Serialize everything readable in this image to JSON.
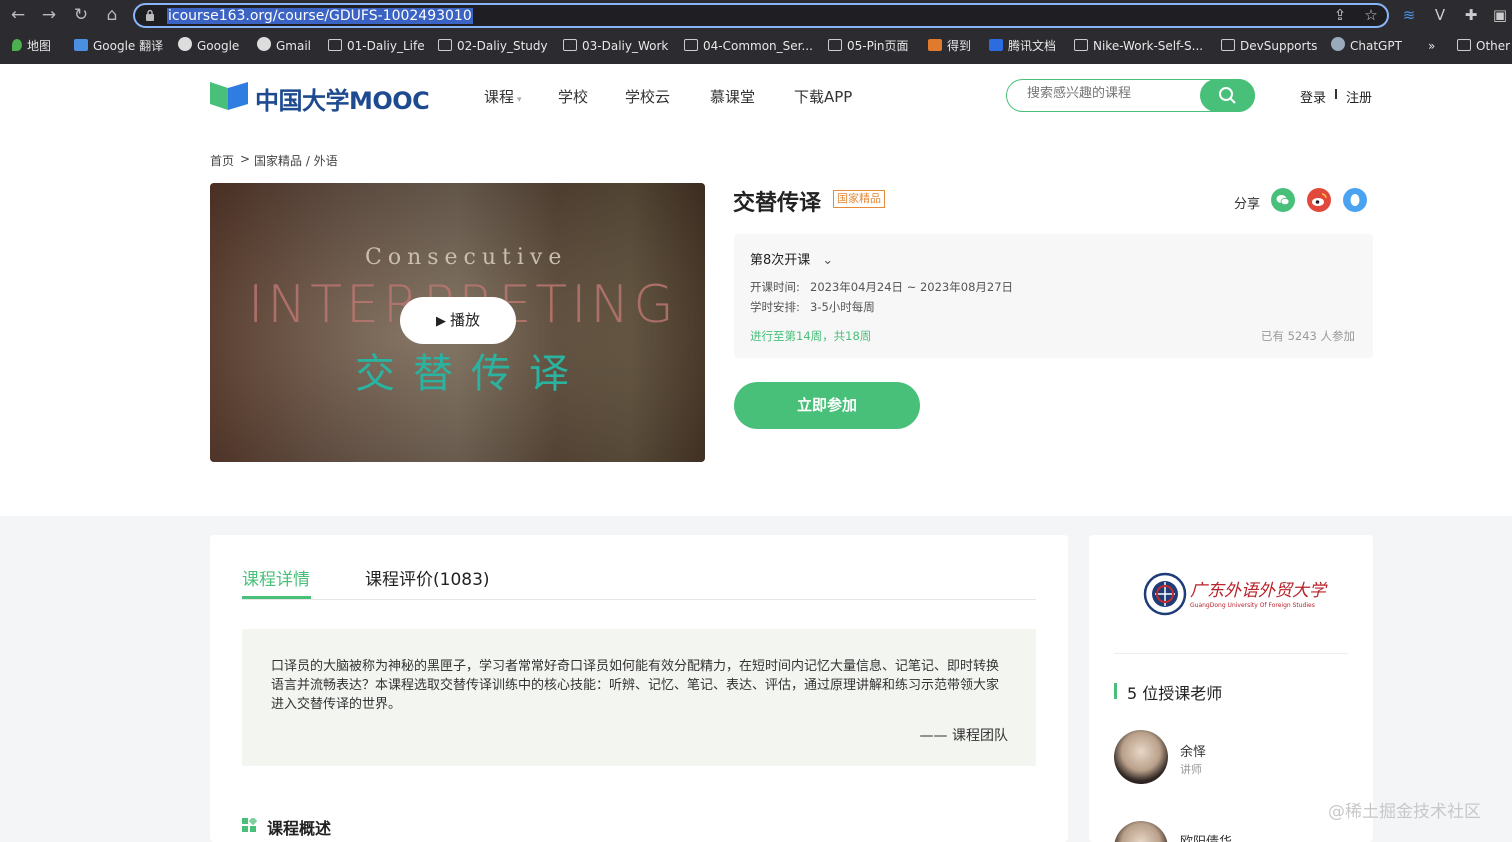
{
  "browser": {
    "url": "icourse163.org/course/GDUFS-1002493010",
    "bookmarks": [
      "地图",
      "Google 翻译",
      "Google",
      "Gmail",
      "01-Daliy_Life",
      "02-Daliy_Study",
      "03-Daliy_Work",
      "04-Common_Ser...",
      "05-Pin页面",
      "得到",
      "腾讯文档",
      "Nike-Work-Self-S...",
      "DevSupports",
      "ChatGPT",
      "»",
      "Other"
    ]
  },
  "header": {
    "logo_text": "中国大学MOOC",
    "nav": [
      "课程",
      "学校",
      "学校云",
      "慕课堂",
      "下载APP"
    ],
    "search_placeholder": "搜索感兴趣的课程",
    "login": "登录",
    "register": "注册"
  },
  "breadcrumb": {
    "home": "首页",
    "sep": ">",
    "category": "国家精品 / 外语"
  },
  "video": {
    "line1": "Consecutive",
    "line2": "INTERPRETING",
    "line3": "交替传译",
    "play_label": "播放"
  },
  "course": {
    "title": "交替传译",
    "badge": "国家精品",
    "share_label": "分享",
    "session": "第8次开课",
    "time_label": "开课时间:",
    "time_value": "2023年04月24日 ~ 2023年08月27日",
    "schedule_label": "学时安排:",
    "schedule_value": "3-5小时每周",
    "progress": "进行至第14周，共18周",
    "enrolled": "已有 5243 人参加",
    "join_label": "立即参加"
  },
  "tabs": [
    "课程详情",
    "课程评价(1083)"
  ],
  "quote": {
    "text": "口译员的大脑被称为神秘的黑匣子，学习者常常好奇口译员如何能有效分配精力，在短时间内记忆大量信息、记笔记、即时转换语言并流畅表达？本课程选取交替传译训练中的核心技能：听辨、记忆、笔记、表达、评估，通过原理讲解和练习示范带领大家进入交替传译的世界。",
    "sign": "—— 课程团队"
  },
  "overview_title": "课程概述",
  "sidebar": {
    "univ_name": "广东外语外贸大学",
    "univ_en": "GuangDong University Of Foreign Studies",
    "teachers_title": "5 位授课老师",
    "teachers": [
      {
        "name": "余怿",
        "role": "讲师"
      },
      {
        "name": "欧阳倩华",
        "role": ""
      }
    ]
  },
  "watermark": "@稀土掘金技术社区",
  "colors": {
    "accent": "#49c07a",
    "badge": "#e48b3a",
    "chrome": "#2b2b30"
  }
}
